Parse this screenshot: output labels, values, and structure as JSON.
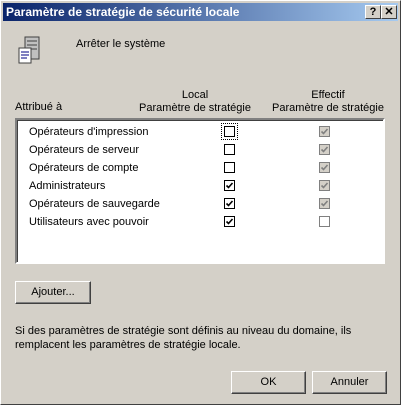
{
  "window": {
    "title": "Paramètre de stratégie de sécurité locale",
    "help": "?",
    "close": "✕"
  },
  "policy": {
    "icon": "policy-server-icon",
    "name": "Arrêter le système"
  },
  "headers": {
    "attribute": "Attribué à",
    "local_line1": "Local",
    "local_line2": "Paramètre de stratégie",
    "effective_line1": "Effectif",
    "effective_line2": "Paramètre de stratégie"
  },
  "rows": [
    {
      "label": "Opérateurs d'impression",
      "local": false,
      "effective": true
    },
    {
      "label": "Opérateurs de serveur",
      "local": false,
      "effective": true
    },
    {
      "label": "Opérateurs de compte",
      "local": false,
      "effective": true
    },
    {
      "label": "Administrateurs",
      "local": true,
      "effective": true
    },
    {
      "label": "Opérateurs de sauvegarde",
      "local": true,
      "effective": true
    },
    {
      "label": "Utilisateurs avec pouvoir",
      "local": true,
      "effective": false
    }
  ],
  "buttons": {
    "add": "Ajouter...",
    "ok": "OK",
    "cancel": "Annuler"
  },
  "note": "Si des paramètres de stratégie sont définis au niveau du domaine, ils remplacent les paramètres de stratégie locale."
}
